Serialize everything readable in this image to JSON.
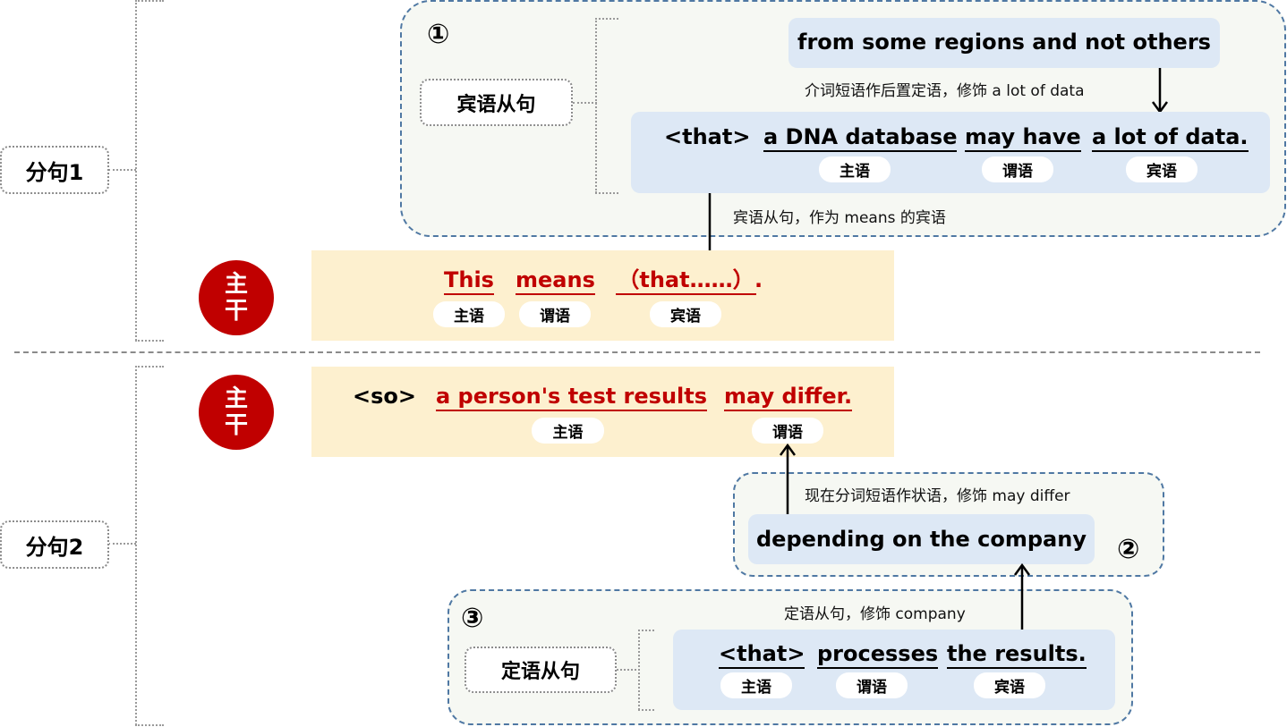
{
  "clauses": [
    {
      "label": "分句1"
    },
    {
      "label": "分句2"
    }
  ],
  "main_badge": {
    "line1": "主",
    "line2": "干"
  },
  "clause1": {
    "group": {
      "number": "①",
      "label": "宾语从句",
      "modifier_phrase": "from some regions and not others",
      "modifier_note": "介词短语作后置定语，修饰 a lot of data",
      "sentence": [
        {
          "text": "<that>",
          "tag": null
        },
        {
          "text": "a DNA database",
          "tag": "主语"
        },
        {
          "text": "may have",
          "tag": "谓语"
        },
        {
          "text": "a lot of data.",
          "tag": "宾语"
        }
      ],
      "link_note": "宾语从句，作为 means 的宾语"
    },
    "main": {
      "sentence": [
        {
          "text": "This",
          "tag": "主语"
        },
        {
          "text": "means",
          "tag": "谓语"
        },
        {
          "text": "（that……）",
          "tag": "宾语"
        },
        {
          "text": ".",
          "tag": null
        }
      ]
    }
  },
  "clause2": {
    "main": {
      "sentence": [
        {
          "text": "<so>",
          "tag": null
        },
        {
          "text": "a person's test results",
          "tag": "主语"
        },
        {
          "text": "may differ.",
          "tag": "谓语"
        }
      ]
    },
    "group2": {
      "number": "②",
      "note": "现在分词短语作状语，修饰 may differ",
      "phrase": "depending on the company"
    },
    "group3": {
      "number": "③",
      "label": "定语从句",
      "note": "定语从句，修饰 company",
      "sentence": [
        {
          "text": "<that>",
          "tag": "主语"
        },
        {
          "text": "processes",
          "tag": "谓语"
        },
        {
          "text": "the results.",
          "tag": "宾语"
        }
      ]
    }
  },
  "colors": {
    "accent_red": "#c00000",
    "blue_box": "#dde8f5",
    "yellow_box": "#fdf0cf",
    "dashed_border": "#4f78a3"
  }
}
